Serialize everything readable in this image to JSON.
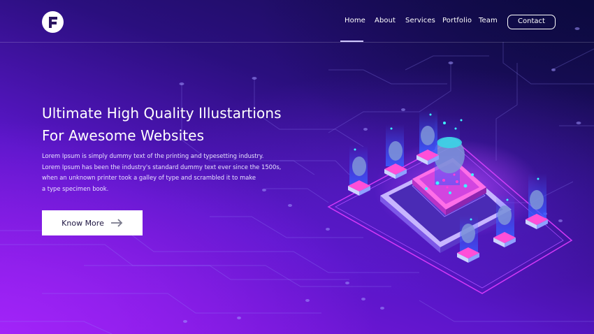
{
  "nav": {
    "logo_icon": "f-letter-logo-icon",
    "items": [
      {
        "label": "Home",
        "active": true
      },
      {
        "label": "About"
      },
      {
        "label": "Services"
      },
      {
        "label": "Portfolio"
      },
      {
        "label": "Team"
      }
    ],
    "contact_label": "Contact"
  },
  "hero": {
    "title_lines": [
      "Ultimate High Quality Illustartions",
      "For Awesome Websites"
    ],
    "text_lines": [
      "Lorem Ipsum is simply dummy text of the printing and typesetting industry.",
      "Lorem Ipsum has been the industry's standard dummy text ever since the 1500s,",
      "when an unknown printer took a galley of type and scrambled it to make",
      "a type specimen book."
    ],
    "button_label": "Know More",
    "button_icon": "arrow-right-icon"
  },
  "colors": {
    "bg_dark": "#130b4a",
    "bg_mid": "#2a0f7e",
    "bg_light": "#8a17e6",
    "accent_cyan": "#3ef3ff",
    "accent_pink": "#ff3fd8",
    "button_bg": "#ffffff",
    "button_text": "#1d1440"
  }
}
